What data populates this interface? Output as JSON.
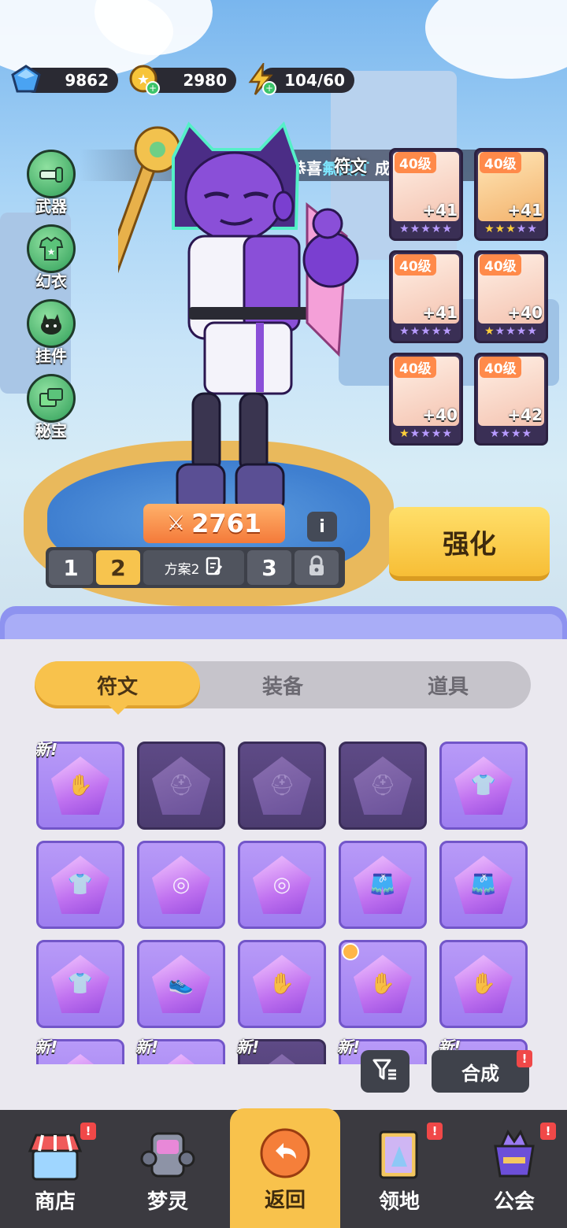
{
  "currency": {
    "gems": "9862",
    "coins": "2980",
    "energy": "104/60"
  },
  "left_menu": [
    {
      "label": "武器",
      "icon": "weapon-icon"
    },
    {
      "label": "幻衣",
      "icon": "outfit-icon"
    },
    {
      "label": "挂件",
      "icon": "pendant-icon"
    },
    {
      "label": "秘宝",
      "icon": "treasure-icon"
    }
  ],
  "banner": {
    "prefix": "恭喜",
    "name": "氟西汀",
    "suffix": "成功集齐梦"
  },
  "rune_tag": "符文",
  "equipment": [
    {
      "level": "40级",
      "plus": "+41",
      "stars": 5,
      "gold": 0
    },
    {
      "level": "40级",
      "plus": "+41",
      "stars": 5,
      "gold": 3
    },
    {
      "level": "40级",
      "plus": "+41",
      "stars": 5,
      "gold": 0
    },
    {
      "level": "40级",
      "plus": "+40",
      "stars": 5,
      "gold": 1
    },
    {
      "level": "40级",
      "plus": "+40",
      "stars": 5,
      "gold": 1
    },
    {
      "level": "40级",
      "plus": "+42",
      "stars": 4,
      "gold": 0
    }
  ],
  "power": "2761",
  "info_label": "i",
  "plan": {
    "slot1": "1",
    "slot2": "2",
    "name": "方案2",
    "slot3": "3"
  },
  "strengthen_label": "强化",
  "tabs": [
    {
      "label": "符文",
      "active": true
    },
    {
      "label": "装备",
      "active": false
    },
    {
      "label": "道具",
      "active": false
    }
  ],
  "new_label": "新!",
  "grid": [
    {
      "dim": false,
      "new": true,
      "glyph": "✋",
      "spark": false
    },
    {
      "dim": true,
      "new": false,
      "glyph": "⛑",
      "spark": false
    },
    {
      "dim": true,
      "new": false,
      "glyph": "⛑",
      "spark": false
    },
    {
      "dim": true,
      "new": false,
      "glyph": "⛑",
      "spark": false
    },
    {
      "dim": false,
      "new": false,
      "glyph": "👕",
      "spark": false
    },
    {
      "dim": false,
      "new": false,
      "glyph": "👕",
      "spark": false
    },
    {
      "dim": false,
      "new": false,
      "glyph": "◎",
      "spark": false
    },
    {
      "dim": false,
      "new": false,
      "glyph": "◎",
      "spark": false
    },
    {
      "dim": false,
      "new": false,
      "glyph": "🩳",
      "spark": false
    },
    {
      "dim": false,
      "new": false,
      "glyph": "🩳",
      "spark": false
    },
    {
      "dim": false,
      "new": false,
      "glyph": "👕",
      "spark": false
    },
    {
      "dim": false,
      "new": false,
      "glyph": "👟",
      "spark": false
    },
    {
      "dim": false,
      "new": false,
      "glyph": "✋",
      "spark": false
    },
    {
      "dim": false,
      "new": false,
      "glyph": "✋",
      "spark": true
    },
    {
      "dim": false,
      "new": false,
      "glyph": "✋",
      "spark": false
    },
    {
      "dim": false,
      "new": true,
      "glyph": "",
      "spark": false
    },
    {
      "dim": false,
      "new": true,
      "glyph": "",
      "spark": false
    },
    {
      "dim": true,
      "new": true,
      "glyph": "",
      "spark": false
    },
    {
      "dim": false,
      "new": true,
      "glyph": "",
      "spark": false
    },
    {
      "dim": false,
      "new": true,
      "glyph": "",
      "spark": false
    }
  ],
  "compose_label": "合成",
  "alert_mark": "!",
  "nav": [
    {
      "label": "商店",
      "alert": true,
      "active": false,
      "icon": "shop-icon"
    },
    {
      "label": "梦灵",
      "alert": false,
      "active": false,
      "icon": "dream-spirit-icon"
    },
    {
      "label": "返回",
      "alert": false,
      "active": true,
      "icon": "back-icon"
    },
    {
      "label": "领地",
      "alert": true,
      "active": false,
      "icon": "territory-icon"
    },
    {
      "label": "公会",
      "alert": true,
      "active": false,
      "icon": "guild-icon"
    }
  ],
  "colors": {
    "accent_yellow": "#f8c24c",
    "panel_purple": "#8e93f0",
    "rune_purple": "#b89af8",
    "alert_red": "#f04848"
  }
}
